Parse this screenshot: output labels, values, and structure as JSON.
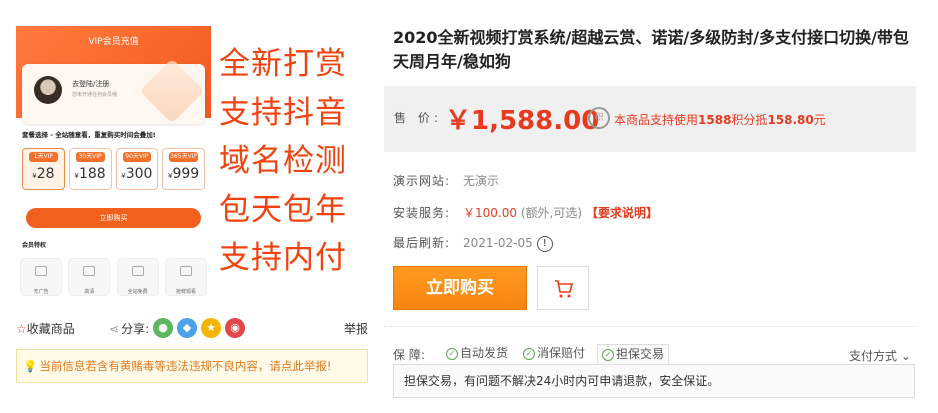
{
  "product_image": {
    "app_title": "VIP会员充值",
    "login_text": "去登陆/注册",
    "login_sub": "您未开通任何会员哦",
    "package_title": "套餐选择 - 全站随意看，重复购买时间会叠加!",
    "packages": [
      {
        "tag": "1天VIP",
        "price": "28"
      },
      {
        "tag": "30天VIP",
        "price": "188"
      },
      {
        "tag": "90天VIP",
        "price": "300"
      },
      {
        "tag": "365天VIP",
        "price": "999"
      }
    ],
    "buy_now": "立即购买",
    "perk_title": "会员特权",
    "perks": [
      "无广告",
      "高清",
      "全站免费",
      "抢鲜观看"
    ],
    "promo_lines": [
      "全新打赏",
      "支持抖音",
      "域名检测",
      "包天包年",
      "支持内付"
    ]
  },
  "actions": {
    "favorite": "收藏商品",
    "share": "分享:",
    "report": "举报"
  },
  "warning": "当前信息若含有黄赌毒等违法违规不良内容，请点此举报!",
  "product": {
    "title": "2020全新视频打赏系统/超越云赏、诺诺/多级防封/多支付接口切换/带包天周月年/稳如狗",
    "price_label": "售 价:",
    "price": "￥1,588.00",
    "points_icon": "积",
    "points_pre": "本商品支持使用",
    "points_amount": "1588",
    "points_mid": "积分抵",
    "points_value": "158.80",
    "points_unit": "元",
    "demo_label": "演示网站:",
    "demo_value": "无演示",
    "install_label": "安装服务:",
    "install_price": "￥100.00",
    "install_note": "(额外,可选)",
    "install_link": "【要求说明】",
    "refresh_label": "最后刷新:",
    "refresh_value": "2021-02-05",
    "buy_button": "立即购买",
    "guarantee_label": "保 障:",
    "guarantees": [
      "自动发货",
      "消保赔付",
      "担保交易"
    ],
    "pay_way": "支付方式",
    "note": "担保交易，有问题不解决24小时内可申请退款，安全保证。"
  },
  "colors": {
    "accent": "#e83a1e",
    "buy_button": "#f78511",
    "promo_red": "#f2430f"
  }
}
